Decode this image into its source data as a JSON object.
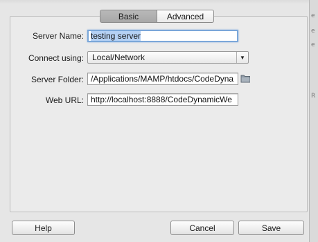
{
  "tabs": {
    "basic_label": "Basic",
    "advanced_label": "Advanced"
  },
  "form": {
    "server_name_label": "Server Name:",
    "server_name_value": "testing server",
    "connect_using_label": "Connect using:",
    "connect_using_value": "Local/Network",
    "server_folder_label": "Server Folder:",
    "server_folder_value": "/Applications/MAMP/htdocs/CodeDyna",
    "web_url_label": "Web URL:",
    "web_url_value": "http://localhost:8888/CodeDynamicWe"
  },
  "buttons": {
    "help_label": "Help",
    "cancel_label": "Cancel",
    "save_label": "Save"
  },
  "icons": {
    "select_arrow": "chevron-down-icon",
    "folder": "folder-icon"
  },
  "colors": {
    "focus_ring": "#7ba7d9",
    "text_selection": "#b5d1f4",
    "active_tab": "#b0b0b0"
  }
}
